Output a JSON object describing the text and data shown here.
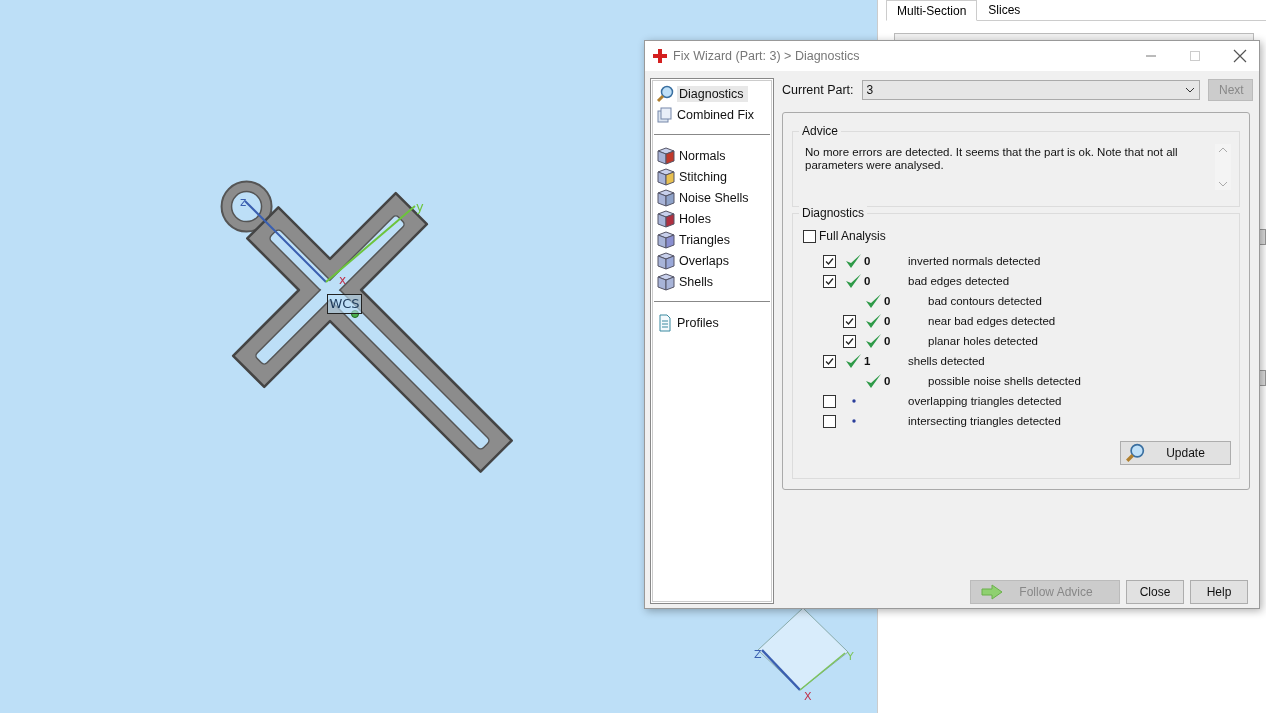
{
  "viewport": {
    "axis_labels": [
      "z",
      "y",
      "x"
    ],
    "wcs_label": "WCS",
    "cube_labels": [
      "Z",
      "Y",
      "X"
    ]
  },
  "side_panel": {
    "tabs": [
      {
        "label": "Multi-Section",
        "selected": true
      },
      {
        "label": "Slices",
        "selected": false
      }
    ]
  },
  "dialog": {
    "title": "Fix Wizard (Part: 3) > Diagnostics",
    "nav": [
      [
        {
          "label": "Diagnostics",
          "selected": true
        },
        {
          "label": "Combined Fix",
          "selected": false
        }
      ],
      [
        {
          "label": "Normals",
          "selected": false
        },
        {
          "label": "Stitching",
          "selected": false
        },
        {
          "label": "Noise Shells",
          "selected": false
        },
        {
          "label": "Holes",
          "selected": false
        },
        {
          "label": "Triangles",
          "selected": false
        },
        {
          "label": "Overlaps",
          "selected": false
        },
        {
          "label": "Shells",
          "selected": false
        }
      ],
      [
        {
          "label": "Profiles",
          "selected": false
        }
      ]
    ],
    "current_part": {
      "label": "Current Part:",
      "value": "3"
    },
    "next_button": {
      "label": "Next",
      "disabled": true
    },
    "advice": {
      "title": "Advice",
      "text": "No more errors are detected. It seems that the part is ok. Note that not all parameters were analysed."
    },
    "diagnostics": {
      "title": "Diagnostics",
      "full_analysis": {
        "label": "Full Analysis",
        "checked": false
      },
      "rows": [
        {
          "kind": "checkbox",
          "checked": true,
          "passed": true,
          "count": "0",
          "label": "inverted normals detected"
        },
        {
          "kind": "checkbox",
          "checked": true,
          "passed": true,
          "count": "0",
          "label": "bad edges detected",
          "children": [
            {
              "kind": "plain",
              "passed": true,
              "count": "0",
              "label": "bad contours detected"
            },
            {
              "kind": "checkbox",
              "checked": true,
              "passed": true,
              "count": "0",
              "label": "near bad edges detected"
            },
            {
              "kind": "checkbox",
              "checked": true,
              "passed": true,
              "count": "0",
              "label": "planar holes detected"
            }
          ]
        },
        {
          "kind": "checkbox",
          "checked": true,
          "passed": true,
          "count": "1",
          "label": "shells detected",
          "children": [
            {
              "kind": "plain",
              "passed": true,
              "count": "0",
              "label": "possible noise shells detected"
            }
          ]
        },
        {
          "kind": "checkbox",
          "checked": false,
          "passed": false,
          "label": "overlapping triangles detected"
        },
        {
          "kind": "checkbox",
          "checked": false,
          "passed": false,
          "label": "intersecting triangles detected"
        }
      ],
      "update_button": "Update"
    },
    "buttons": [
      {
        "label": "Follow Advice",
        "disabled": true
      },
      {
        "label": "Close",
        "disabled": false
      },
      {
        "label": "Help",
        "disabled": false
      }
    ]
  }
}
